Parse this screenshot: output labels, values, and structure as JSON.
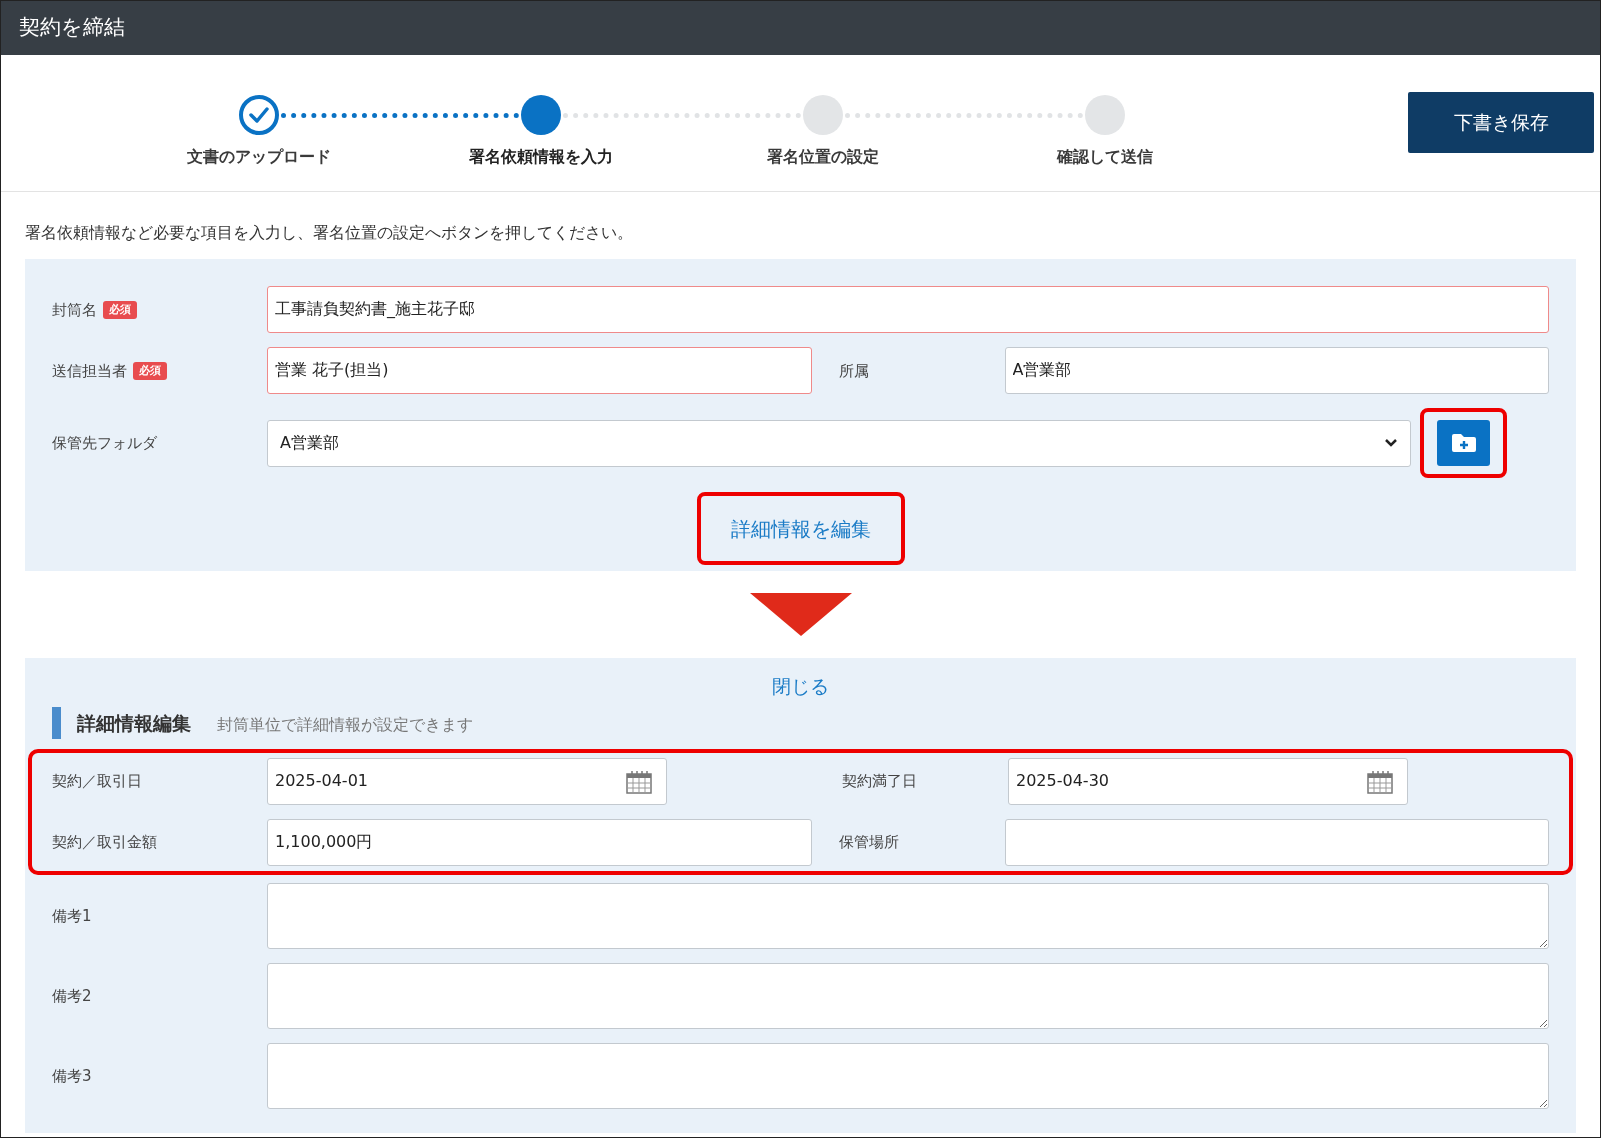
{
  "window": {
    "title": "契約を締結"
  },
  "steps": [
    {
      "label": "文書のアップロード",
      "done": true,
      "selected": false
    },
    {
      "label": "署名依頼情報を入力",
      "done": false,
      "selected": true
    },
    {
      "label": "署名位置の設定",
      "done": false,
      "selected": false
    },
    {
      "label": "確認して送信",
      "done": false,
      "selected": false
    }
  ],
  "save_draft_button": "下書き保存",
  "instruction": "署名依頼情報など必要な項目を入力し、署名位置の設定へボタンを押してください。",
  "basic_form": {
    "envelope_name": {
      "label": "封筒名",
      "required": true,
      "badge": "必須",
      "value": "工事請負契約書_施主花子邸"
    },
    "sender": {
      "label": "送信担当者",
      "required": true,
      "badge": "必須",
      "value": "営業 花子(担当)"
    },
    "department": {
      "label": "所属",
      "required": false,
      "value": "A営業部"
    },
    "folder": {
      "label": "保管先フォルダ",
      "value": "A営業部"
    },
    "edit_details_link": "詳細情報を編集"
  },
  "details": {
    "close_link": "閉じる",
    "heading": "詳細情報編集",
    "subheading": "封筒単位で詳細情報が設定できます",
    "fields": [
      {
        "label": "契約／取引日",
        "kind": "date",
        "value": "2025-04-01"
      },
      {
        "label": "契約満了日",
        "kind": "date",
        "value": "2025-04-30"
      },
      {
        "label": "契約／取引金額",
        "kind": "text",
        "value": "1,100,000円"
      },
      {
        "label": "保管場所",
        "kind": "text"
      }
    ],
    "notes": [
      {
        "label": "備考1"
      },
      {
        "label": "備考2"
      },
      {
        "label": "備考3"
      }
    ]
  }
}
